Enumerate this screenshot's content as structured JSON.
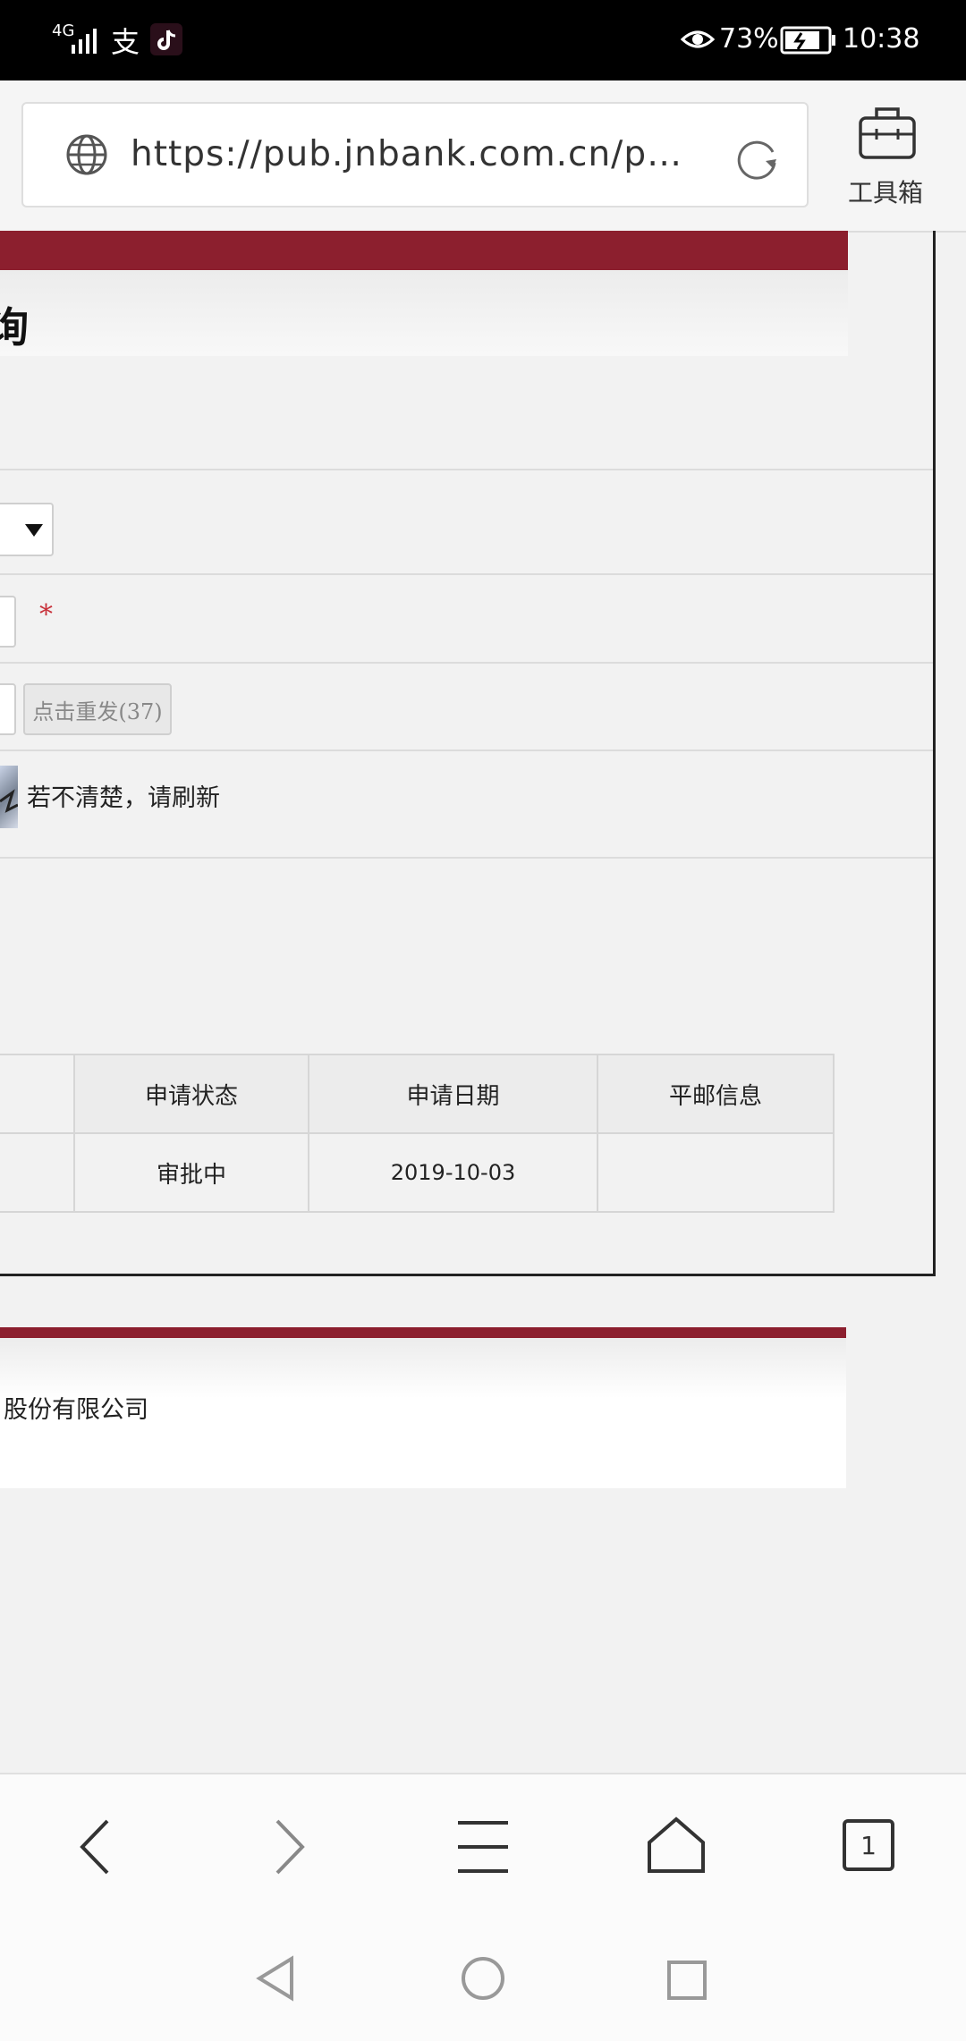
{
  "status_bar": {
    "signal_text": "4G",
    "battery_percent": "73%",
    "time": "10:38",
    "charging_icon": "battery-charging-icon"
  },
  "browser": {
    "url": "https://pub.jnbank.com.cn/pwe···",
    "toolbox_label": "工具箱",
    "icons": {
      "globe": "globe-icon",
      "reload": "reload-icon",
      "toolbox": "toolbox-icon"
    }
  },
  "page": {
    "title_fragment": "询",
    "required_mark": "*",
    "resend_button": "点击重发(37)",
    "captcha_hint": "若不清楚，请刷新"
  },
  "table": {
    "headers": [
      "申请状态",
      "申请日期",
      "平邮信息"
    ],
    "rows": [
      [
        "审批中",
        "2019-10-03",
        ""
      ]
    ]
  },
  "footer": {
    "company_fragment": "股份有限公司"
  },
  "nav": {
    "tab_count": "1",
    "icons": [
      "back-icon",
      "forward-icon",
      "menu-icon",
      "home-icon",
      "tabs-icon"
    ]
  },
  "colors": {
    "accent": "#8c1f2e",
    "required": "#c8313a"
  }
}
